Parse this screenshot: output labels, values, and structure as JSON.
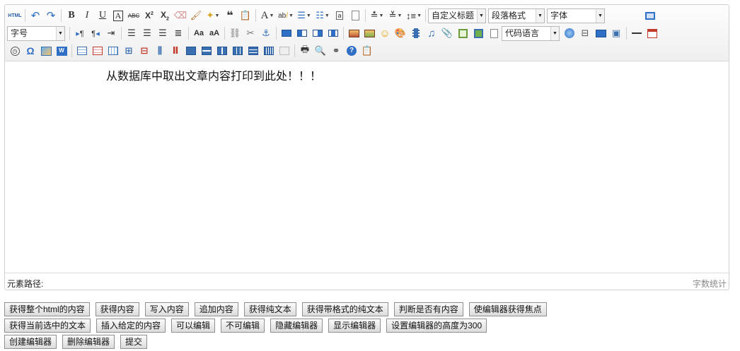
{
  "toolbar": {
    "row1_text": {
      "html": "HTML"
    },
    "custom_title_combo": "自定义标题",
    "paragraph_combo": "段落格式",
    "font_combo": "字体",
    "size_combo": "字号",
    "code_combo": "代码语言"
  },
  "content": {
    "text": "从数据库中取出文章内容打印到此处！！！"
  },
  "statusbar": {
    "path_label": "元素路径:",
    "word_count_label": "字数统计"
  },
  "actions": {
    "row1": [
      "获得整个html的内容",
      "获得内容",
      "写入内容",
      "追加内容",
      "获得纯文本",
      "获得带格式的纯文本",
      "判断是否有内容",
      "使编辑器获得焦点"
    ],
    "row2": [
      "获得当前选中的文本",
      "插入给定的内容",
      "可以编辑",
      "不可编辑",
      "隐藏编辑器",
      "显示编辑器",
      "设置编辑器的高度为300"
    ],
    "row3": [
      "创建编辑器",
      "删除编辑器",
      "提交"
    ]
  },
  "icons": {
    "accent_blue": "#3a7bd5",
    "toolbar_bg": "#efefef"
  }
}
